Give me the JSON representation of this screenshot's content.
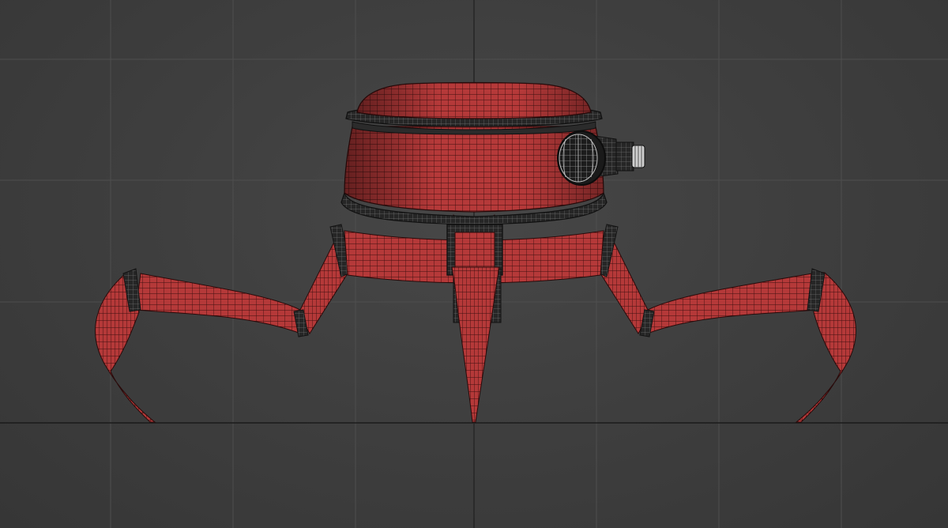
{
  "viewport": {
    "background_color": "#3f3f3f",
    "grid_color": "#4e4e4e",
    "axis_color": "#1e1e1e"
  },
  "model": {
    "surface_color": "#b83a3a",
    "wire_color": "#3a1010",
    "metal_color": "#2a2a2a",
    "metal_wire_color": "#808080",
    "parts": [
      "dome-lid",
      "lid-ring",
      "body",
      "base-ring",
      "eye-lens",
      "side-knob",
      "neck",
      "front-leg",
      "left-leg",
      "right-leg",
      "back-legs-bridge"
    ]
  }
}
